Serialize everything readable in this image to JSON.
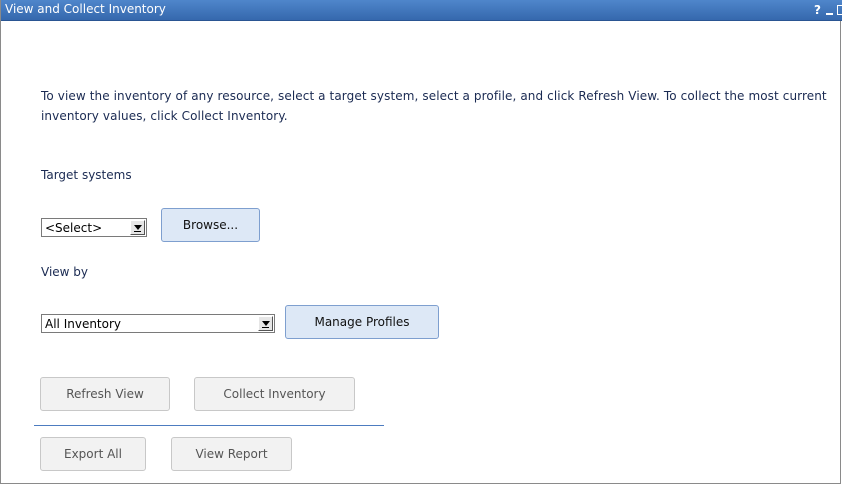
{
  "window": {
    "title": "View and Collect Inventory",
    "help_label": "?"
  },
  "intro_text": "To view the inventory of any resource, select a target system, select a profile, and click Refresh View. To collect the most current inventory values, click Collect Inventory.",
  "target_systems": {
    "label": "Target systems",
    "selected_value": "<Select>",
    "browse_label": "Browse..."
  },
  "view_by": {
    "label": "View by",
    "selected_value": "All Inventory",
    "manage_profiles_label": "Manage Profiles"
  },
  "actions": {
    "refresh_view_label": "Refresh View",
    "collect_inventory_label": "Collect Inventory",
    "export_all_label": "Export All",
    "view_report_label": "View Report"
  }
}
